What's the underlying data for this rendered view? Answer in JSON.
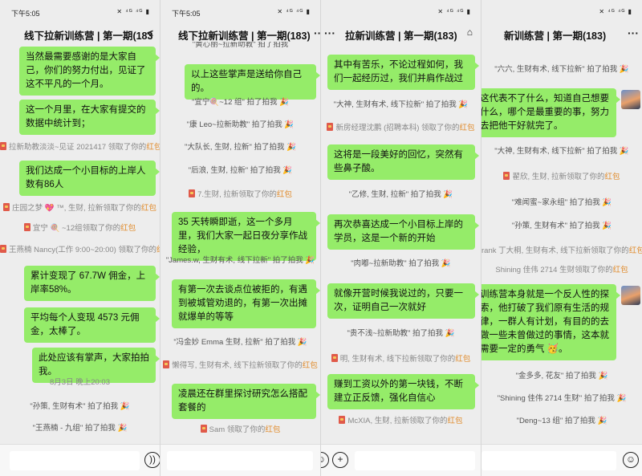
{
  "status": {
    "time": "下午5:05",
    "icons": "✕ ⁴ᴳ ⁴ᴳ ▮"
  },
  "panels": [
    {
      "title": "线下拉新训练营 | 第一期(183",
      "title_right": "<",
      "bubbles": [
        "当然最需要感谢的是大家自己，你们的努力付出，见证了这不平凡的一个月。",
        "这一个月里，在大家有提交的数据中统计到；",
        "我们达成一个小目标的上岸人数有86人",
        "累计变现了 67.7W 佣金，上岸率58%。",
        "平均每个人变现 4573 元佣金，太棒了。",
        "此处应该有掌声，大家拍拍我。"
      ],
      "system": [
        "拉新助教淡淡~见证 2021417 领取了你的",
        "庄园之梦 💖 ™, 生财, 拉新领取了你的",
        "宜宁 🍭 ~12组领取了你的",
        "王燕楠 Nancy(工作 9:00~20:00) 领取了你的"
      ],
      "time_label": "8月3日 晚上20:03",
      "pats": [
        "\"孙策, 生财有术\" 拍了拍我 🎉",
        "\"王燕楠 - 九组\" 拍了拍我 🎉"
      ]
    },
    {
      "title": "线下拉新训练营 | 第一期(183)",
      "title_right": "···",
      "top_cut": "\"黄心丽~拉新助教\" 拍了拍我",
      "bubbles": [
        "以上这些掌声是送给你自己的。",
        "35 天转瞬即逝，这一个多月里，我们大家一起日夜分享作战经验，",
        "有第一次去谈点位被拒的，有遇到被城管劝退的，有第一次出摊就爆单的等等",
        "凌晨还在群里探讨研究怎么搭配套餐的"
      ],
      "pats": [
        "\"宜宁🍭~12 组\" 拍了拍我 🎉",
        "\"康 Leo~拉新助教\" 拍了拍我 🎉",
        "\"大队长, 生财, 拉新\" 拍了拍我 🎉",
        "\"后浪, 生财, 拉新\" 拍了拍我 🎉",
        "\"James.w, 生财有术, 线下拉新\" 拍了拍我 🎉",
        "\"冯金妙 Emma 生财, 拉新\" 拍了拍我 🎉"
      ],
      "system": [
        "7.生财, 拉新领取了你的",
        "懒得写, 生财有术, 线下拉新领取了你的",
        "Sam 领取了你的"
      ]
    },
    {
      "title": "拉新训练营 | 第一期(183)",
      "title_left": "···",
      "title_right": "⌂",
      "bubbles": [
        "其中有苦乐，不论过程如何，我们一起经历过，我们并肩作战过",
        "这将是一段美好的回忆，突然有些鼻子酸。",
        "再次恭喜达成一个小目标上岸的学员，这是一个新的开始",
        "就像开营时候我说过的，只要一次，证明自己一次就好",
        "赚到工资以外的第一块钱，不断建立正反馈，强化自信心"
      ],
      "pats": [
        "\"大神, 生财有术, 线下拉新\" 拍了拍我 🎉",
        "\"乙修, 生财, 拉新\" 拍了拍我 🎉",
        "\"肉嘟~拉新助教\" 拍了拍我 🎉",
        "\"贵不浅~拉新助教\" 拍了拍我 🎉"
      ],
      "system": [
        "新房经理沈鹏 (招聘本科) 领取了你的",
        "明, 生财有术, 线下拉新领取了你的",
        "McXIA, 生财, 拉新领取了你的"
      ]
    },
    {
      "title": "新训练营 | 第一期(183)",
      "title_right": "···",
      "bubbles": [
        "这代表不了什么，知道自己想要什么，哪个是最重要的事，努力去把他干好就完了。",
        "训练营本身就是一个反人性的探索，他打破了我们原有生活的规律，一群人有计划，有目的的去做一些未曾做过的事情，这本就需要一定的勇气 🥳。"
      ],
      "pats": [
        "\"六六, 生财有术, 线下拉新\" 拍了拍我 🎉",
        "\"大神, 生财有术, 线下拉新\" 拍了拍我 🎉",
        "\"难闻蜜~家永组\" 拍了拍我 🎉",
        "\"孙策, 生财有术\" 拍了拍我 🎉",
        "\"金多多, 花友\" 拍了拍我 🎉",
        "\"Shining 佳伟 2714 生财\" 拍了拍我 🎉",
        "\"Deng~13 组\" 拍了拍我 🎉"
      ],
      "system": [
        "翟欣, 生财, 拉新领取了你的",
        "rank 丁大桐, 生财有术, 线下拉新领取了你的",
        "Shining 佳伟 2714 生财领取了你的"
      ]
    }
  ],
  "hongbao": "红包"
}
